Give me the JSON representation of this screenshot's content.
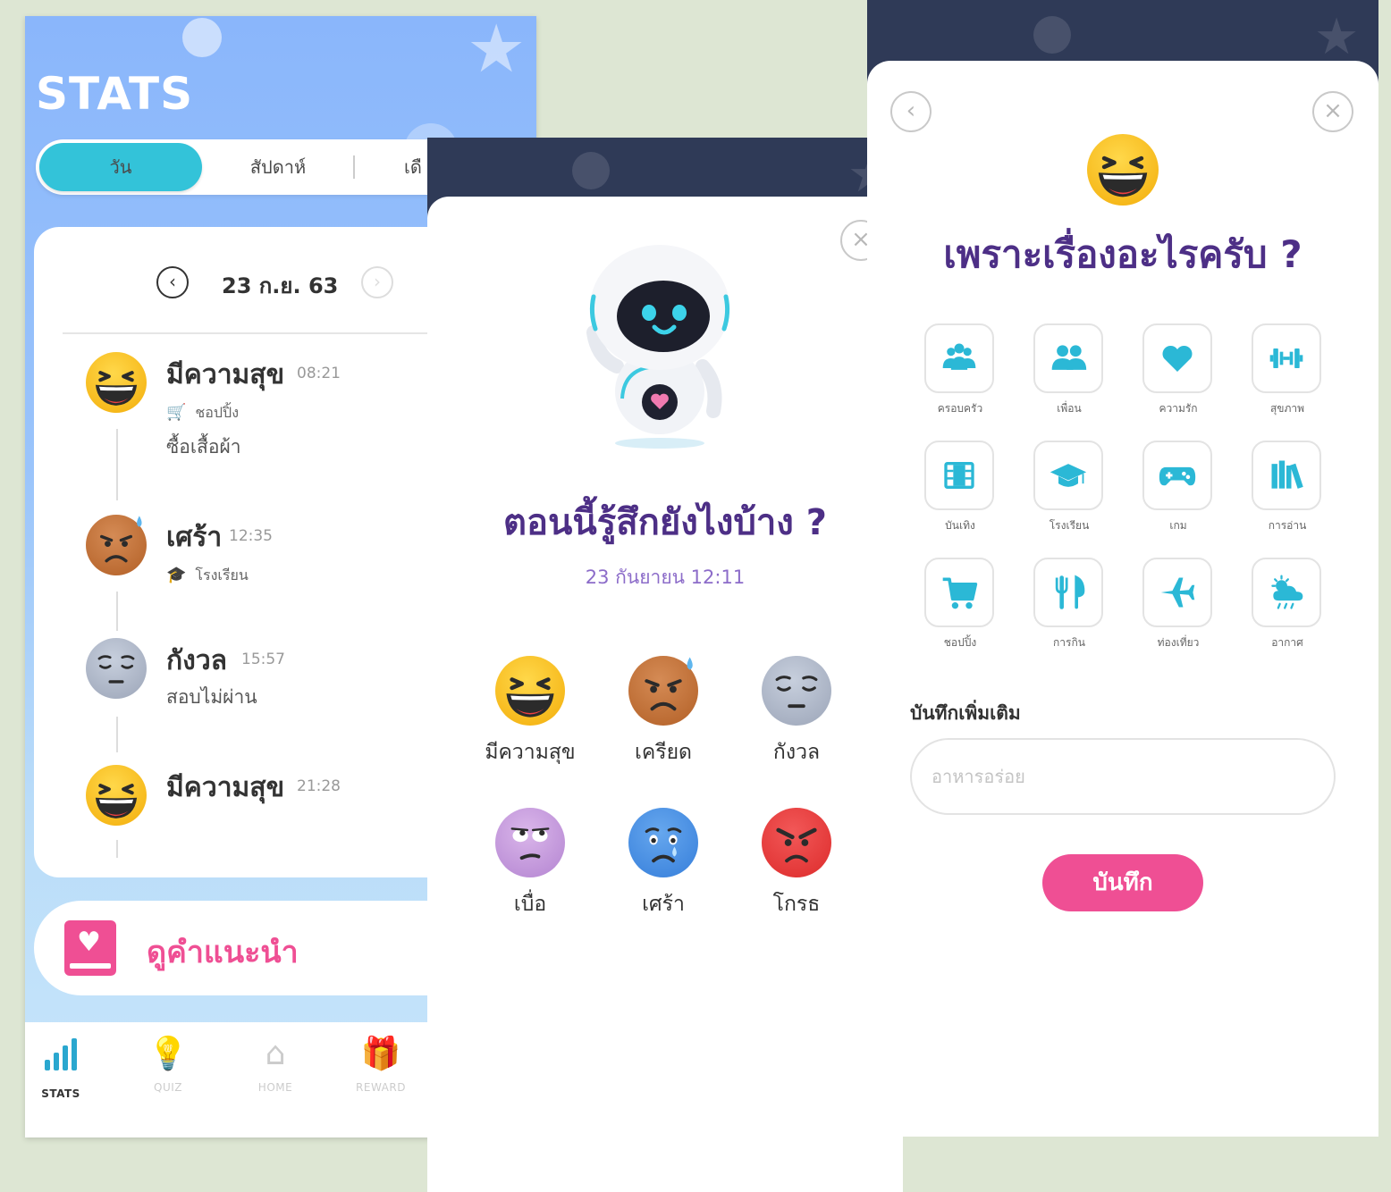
{
  "stats": {
    "title": "STATS",
    "tabs": [
      "วัน",
      "สัปดาห์",
      "เดื"
    ],
    "date": "23 ก.ย. 63",
    "entries": [
      {
        "mood": "มีความสุข",
        "time": "08:21",
        "tag": "ชอปปิ้ง",
        "note": "ซื้อเสื้อผ้า",
        "emoji": "happy-face-icon",
        "tag_icon": "cart-icon"
      },
      {
        "mood": "เศร้า",
        "time": "12:35",
        "tag": "โรงเรียน",
        "note": "",
        "emoji": "sweating-face-icon",
        "tag_icon": "graduation-cap-icon"
      },
      {
        "mood": "กังวล",
        "time": "15:57",
        "tag": "",
        "note": "สอบไม่ผ่าน",
        "emoji": "worried-face-icon",
        "tag_icon": ""
      },
      {
        "mood": "มีความสุข",
        "time": "21:28",
        "tag": "",
        "note": "",
        "emoji": "happy-face-icon",
        "tag_icon": ""
      }
    ],
    "advice_label": "ดูคำแนะนำ",
    "nav": [
      {
        "label": "STATS",
        "icon": "bar-chart-icon"
      },
      {
        "label": "QUIZ",
        "icon": "lightbulb-icon"
      },
      {
        "label": "HOME",
        "icon": "home-icon"
      },
      {
        "label": "REWARD",
        "icon": "gift-icon"
      }
    ]
  },
  "mood_picker": {
    "question": "ตอนนี้รู้สึกยังไงบ้าง ?",
    "datetime": "23 กันยายน 12:11",
    "close_icon": "close-icon",
    "options": [
      {
        "label": "มีความสุข",
        "icon": "happy-face-icon"
      },
      {
        "label": "เครียด",
        "icon": "stressed-face-icon"
      },
      {
        "label": "กังวล",
        "icon": "worried-face-icon"
      },
      {
        "label": "เบื่อ",
        "icon": "bored-face-icon"
      },
      {
        "label": "เศร้า",
        "icon": "crying-face-icon"
      },
      {
        "label": "โกรธ",
        "icon": "angry-face-icon"
      }
    ]
  },
  "reason_picker": {
    "question": "เพราะเรื่องอะไรครับ ?",
    "categories": [
      {
        "label": "ครอบครัว",
        "icon": "family-icon"
      },
      {
        "label": "เพื่อน",
        "icon": "friends-icon"
      },
      {
        "label": "ความรัก",
        "icon": "heart-icon"
      },
      {
        "label": "สุขภาพ",
        "icon": "dumbbell-icon"
      },
      {
        "label": "บันเทิง",
        "icon": "film-icon"
      },
      {
        "label": "โรงเรียน",
        "icon": "graduation-cap-icon"
      },
      {
        "label": "เกม",
        "icon": "gamepad-icon"
      },
      {
        "label": "การอ่าน",
        "icon": "books-icon"
      },
      {
        "label": "ชอปปิ้ง",
        "icon": "cart-icon"
      },
      {
        "label": "การกิน",
        "icon": "utensils-icon"
      },
      {
        "label": "ท่องเที่ยว",
        "icon": "airplane-icon"
      },
      {
        "label": "อากาศ",
        "icon": "weather-icon"
      }
    ],
    "note_label": "บันทึกเพิ่มเติม",
    "note_placeholder": "อาหารอร่อย",
    "save_label": "บันทึก"
  },
  "colors": {
    "accent_cyan": "#33c3d9",
    "pink": "#ef4f94",
    "purple_heading": "#4d2f86",
    "navy_header": "#2f3a57"
  }
}
